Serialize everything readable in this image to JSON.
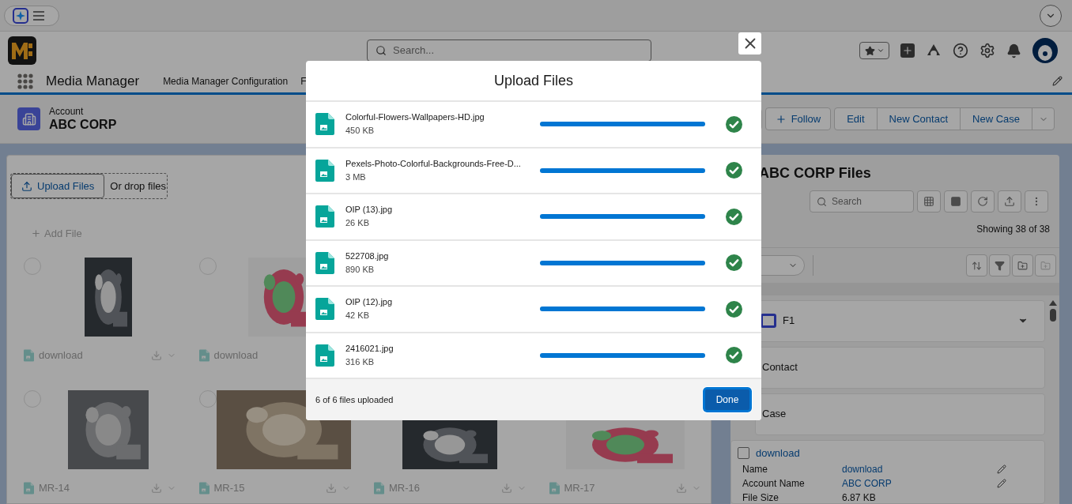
{
  "header": {
    "search": {
      "placeholder": "Search..."
    }
  },
  "nav": {
    "app_name": "Media Manager",
    "items": [
      "Media Manager Configuration",
      "F"
    ]
  },
  "record": {
    "type": "Account",
    "name": "ABC CORP",
    "actions": [
      "Follow",
      "Edit",
      "New Contact",
      "New Case"
    ]
  },
  "left_panel": {
    "upload_button": "Upload Files",
    "drop_hint": "Or drop files",
    "add_file": "Add File",
    "files": [
      {
        "name": "download",
        "selected": false
      },
      {
        "name": "download",
        "selected": false
      },
      {
        "name": "MR-14",
        "selected": false
      },
      {
        "name": "MR-15",
        "selected": false
      },
      {
        "name": "MR-16"
      },
      {
        "name": "MR-17"
      }
    ]
  },
  "right_panel": {
    "title": "ABC CORP Files",
    "search": {
      "placeholder": "Search"
    },
    "count": "Showing 38 of 38",
    "groups": [
      "F1",
      "Contact",
      "Case"
    ],
    "record": {
      "title": "download",
      "checked": false,
      "fields": [
        {
          "label": "Name",
          "value": "download"
        },
        {
          "label": "Account Name",
          "value": "ABC CORP"
        },
        {
          "label": "File Size",
          "value": "6.87 KB"
        }
      ]
    }
  },
  "modal": {
    "title": "Upload Files",
    "files": [
      {
        "name": "Colorful-Flowers-Wallpapers-HD.jpg",
        "size": "450 KB",
        "level": 1,
        "done": true
      },
      {
        "name": "Pexels-Photo-Colorful-Backgrounds-Free-D...",
        "size": "3 MB",
        "level": 1,
        "done": true
      },
      {
        "name": "OIP (13).jpg",
        "size": "26 KB",
        "level": 1,
        "done": true
      },
      {
        "name": "522708.jpg",
        "size": "890 KB",
        "level": 1,
        "done": true
      },
      {
        "name": "OIP (12).jpg",
        "size": "42 KB",
        "level": 1,
        "done": true
      },
      {
        "name": "2416021.jpg",
        "size": "316 KB",
        "level": 1,
        "done": true
      }
    ],
    "status": "6 of 6 files uploaded",
    "done_button": "Done"
  }
}
